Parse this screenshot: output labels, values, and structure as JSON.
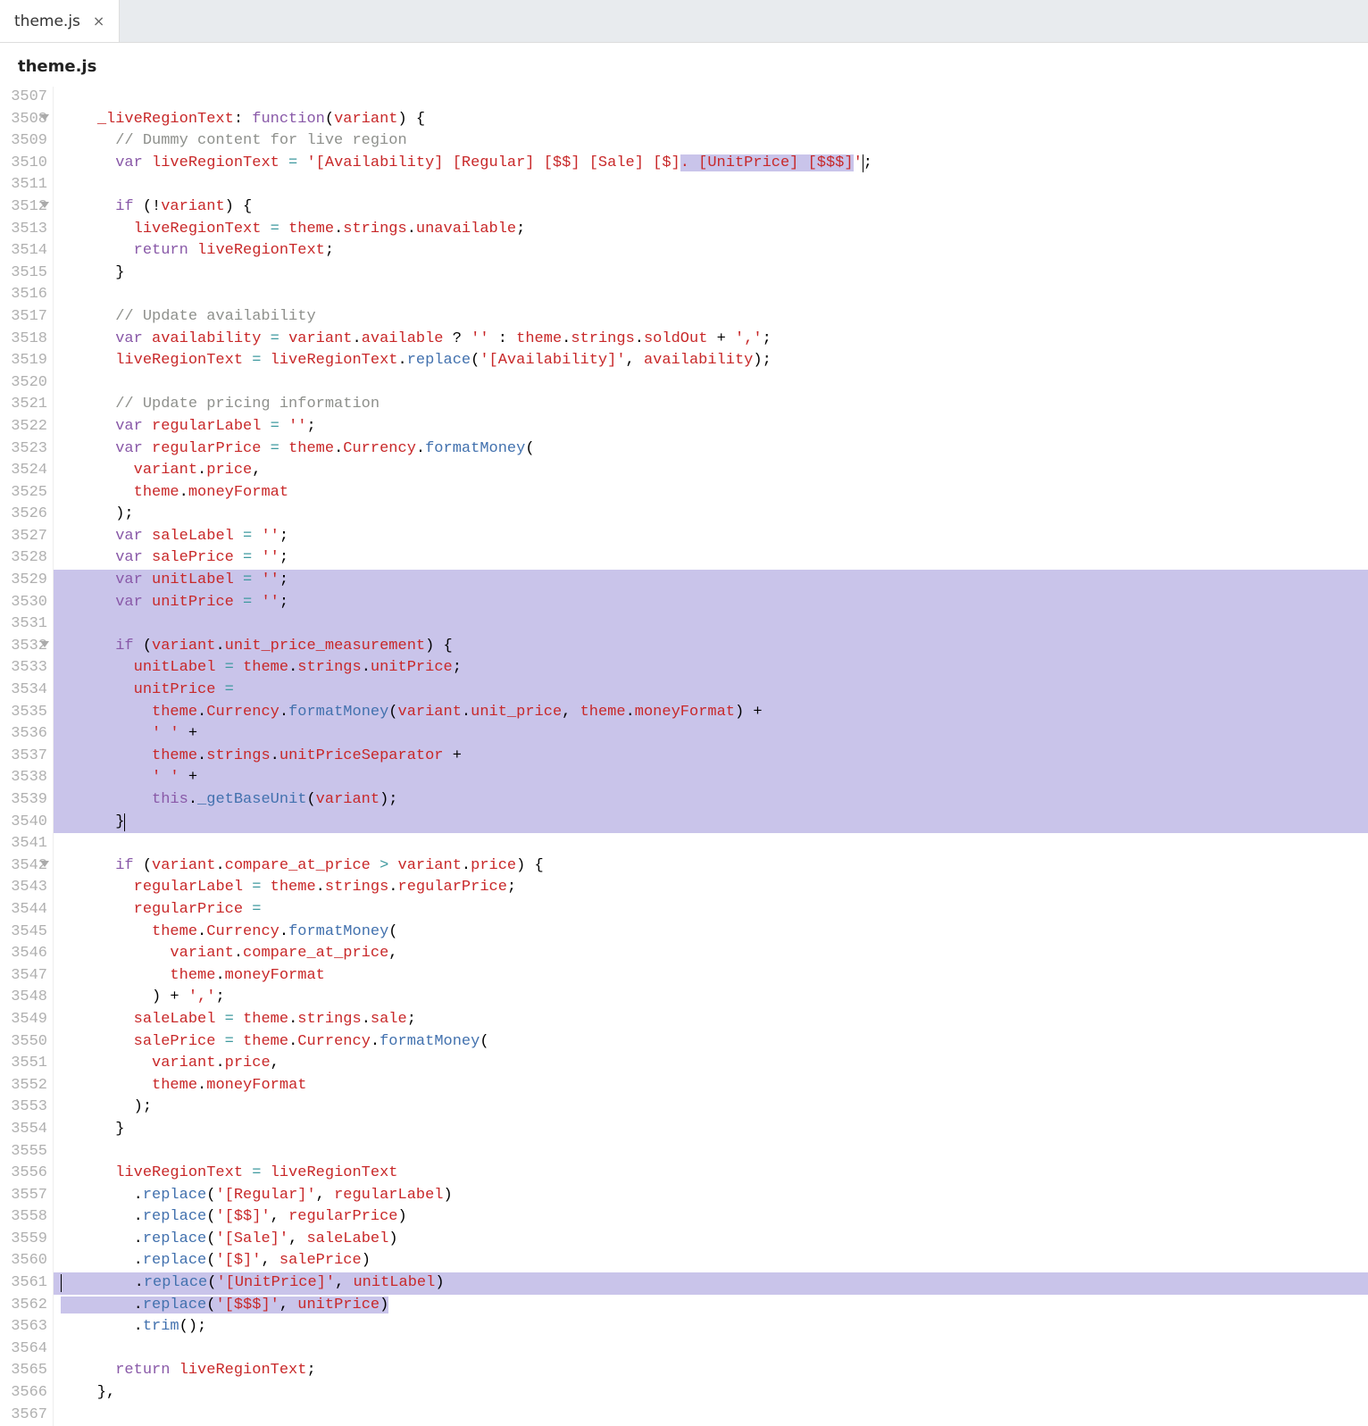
{
  "tab": {
    "label": "theme.js",
    "closeIcon": "×"
  },
  "breadcrumb": "theme.js",
  "lineNumbers": [
    "3507",
    "3508",
    "3509",
    "3510",
    "3511",
    "3512",
    "3513",
    "3514",
    "3515",
    "3516",
    "3517",
    "3518",
    "3519",
    "3520",
    "3521",
    "3522",
    "3523",
    "3524",
    "3525",
    "3526",
    "3527",
    "3528",
    "3529",
    "3530",
    "3531",
    "3532",
    "3533",
    "3534",
    "3535",
    "3536",
    "3537",
    "3538",
    "3539",
    "3540",
    "3541",
    "3542",
    "3543",
    "3544",
    "3545",
    "3546",
    "3547",
    "3548",
    "3549",
    "3550",
    "3551",
    "3552",
    "3553",
    "3554",
    "3555",
    "3556",
    "3557",
    "3558",
    "3559",
    "3560",
    "3561",
    "3562",
    "3563",
    "3564",
    "3565",
    "3566",
    "3567"
  ],
  "foldLines": [
    "3508",
    "3512",
    "3532",
    "3542"
  ],
  "code": {
    "l3507": "",
    "l3508": {
      "indent": "    ",
      "prop": "_liveRegionText",
      "colon": ": ",
      "fn": "function",
      "paren": "(",
      "arg": "variant",
      "rest": ") {"
    },
    "l3509": "      // Dummy content for live region",
    "l3510": {
      "pre": "      ",
      "kw": "var",
      "sp": " ",
      "name": "liveRegionText",
      "eq": " = ",
      "str_a": "'[Availability] [Regular] [$$] [Sale] [$]",
      "str_hl": ". [UnitPrice] [$$$]",
      "str_end": "'",
      "semi": ";"
    },
    "l3511": "",
    "l3512": {
      "pre": "      ",
      "kw": "if",
      "rest": " (!",
      "var": "variant",
      "end": ") {"
    },
    "l3513": {
      "pre": "        ",
      "a": "liveRegionText",
      "b": " = ",
      "c": "theme",
      "d": ".",
      "e": "strings",
      "f": ".",
      "g": "unavailable",
      "h": ";"
    },
    "l3514": {
      "pre": "        ",
      "kw": "return",
      "sp": " ",
      "v": "liveRegionText",
      "semi": ";"
    },
    "l3515": "      }",
    "l3516": "",
    "l3517": "      // Update availability",
    "l3518": {
      "pre": "      ",
      "kw": "var",
      "name": " availability",
      "eq": " = ",
      "a": "variant",
      "b": ".",
      "c": "available",
      "q": " ? ",
      "s1": "''",
      "col": " : ",
      "d": "theme",
      "e": ".",
      "f": "strings",
      "g": ".",
      "h": "soldOut",
      "plus": " + ",
      "s2": "','",
      "semi": ";"
    },
    "l3519": {
      "pre": "      ",
      "a": "liveRegionText",
      "eq": " = ",
      "b": "liveRegionText",
      "c": ".",
      "d": "replace",
      "paren": "(",
      "s": "'[Availability]'",
      "com": ", ",
      "e": "availability",
      "end": ");"
    },
    "l3520": "",
    "l3521": "      // Update pricing information",
    "l3522": {
      "pre": "      ",
      "kw": "var",
      "name": " regularLabel",
      "eq": " = ",
      "s": "''",
      "semi": ";"
    },
    "l3523": {
      "pre": "      ",
      "kw": "var",
      "name": " regularPrice",
      "eq": " = ",
      "a": "theme",
      "b": ".",
      "c": "Currency",
      "d": ".",
      "e": "formatMoney",
      "paren": "("
    },
    "l3524": {
      "pre": "        ",
      "a": "variant",
      "b": ".",
      "c": "price",
      "com": ","
    },
    "l3525": {
      "pre": "        ",
      "a": "theme",
      "b": ".",
      "c": "moneyFormat"
    },
    "l3526": "      );",
    "l3527": {
      "pre": "      ",
      "kw": "var",
      "name": " saleLabel",
      "eq": " = ",
      "s": "''",
      "semi": ";"
    },
    "l3528": {
      "pre": "      ",
      "kw": "var",
      "name": " salePrice",
      "eq": " = ",
      "s": "''",
      "semi": ";"
    },
    "l3529": {
      "pre": "      ",
      "kw": "var",
      "name": " unitLabel",
      "eq": " = ",
      "s": "''",
      "semi": ";"
    },
    "l3530": {
      "pre": "      ",
      "kw": "var",
      "name": " unitPrice",
      "eq": " = ",
      "s": "''",
      "semi": ";"
    },
    "l3531": "",
    "l3532": {
      "pre": "      ",
      "kw": "if",
      "paren": " (",
      "a": "variant",
      "b": ".",
      "c": "unit_price_measurement",
      "end": ") {"
    },
    "l3533": {
      "pre": "        ",
      "a": "unitLabel",
      "eq": " = ",
      "b": "theme",
      "c": ".",
      "d": "strings",
      "e": ".",
      "f": "unitPrice",
      "g": ";"
    },
    "l3534": {
      "pre": "        ",
      "a": "unitPrice",
      "eq": " ="
    },
    "l3535": {
      "pre": "          ",
      "a": "theme",
      "b": ".",
      "c": "Currency",
      "d": ".",
      "e": "formatMoney",
      "paren": "(",
      "f": "variant",
      "g": ".",
      "h": "unit_price",
      "com": ", ",
      "i": "theme",
      "j": ".",
      "k": "moneyFormat",
      "end": ") +"
    },
    "l3536": {
      "pre": "          ",
      "s": "' '",
      "plus": " +"
    },
    "l3537": {
      "pre": "          ",
      "a": "theme",
      "b": ".",
      "c": "strings",
      "d": ".",
      "e": "unitPriceSeparator",
      "plus": " +"
    },
    "l3538": {
      "pre": "          ",
      "s": "' '",
      "plus": " +"
    },
    "l3539": {
      "pre": "          ",
      "th": "this",
      "b": ".",
      "c": "_getBaseUnit",
      "paren": "(",
      "d": "variant",
      "end": ");"
    },
    "l3540": "      }",
    "l3541": "",
    "l3542": {
      "pre": "      ",
      "kw": "if",
      "paren": " (",
      "a": "variant",
      "b": ".",
      "c": "compare_at_price",
      "op": " > ",
      "d": "variant",
      "e": ".",
      "f": "price",
      "end": ") {"
    },
    "l3543": {
      "pre": "        ",
      "a": "regularLabel",
      "eq": " = ",
      "b": "theme",
      "c": ".",
      "d": "strings",
      "e": ".",
      "f": "regularPrice",
      "g": ";"
    },
    "l3544": {
      "pre": "        ",
      "a": "regularPrice",
      "eq": " ="
    },
    "l3545": {
      "pre": "          ",
      "a": "theme",
      "b": ".",
      "c": "Currency",
      "d": ".",
      "e": "formatMoney",
      "paren": "("
    },
    "l3546": {
      "pre": "            ",
      "a": "variant",
      "b": ".",
      "c": "compare_at_price",
      "com": ","
    },
    "l3547": {
      "pre": "            ",
      "a": "theme",
      "b": ".",
      "c": "moneyFormat"
    },
    "l3548": {
      "pre": "          ) + ",
      "s": "','",
      "semi": ";"
    },
    "l3549": {
      "pre": "        ",
      "a": "saleLabel",
      "eq": " = ",
      "b": "theme",
      "c": ".",
      "d": "strings",
      "e": ".",
      "f": "sale",
      "g": ";"
    },
    "l3550": {
      "pre": "        ",
      "a": "salePrice",
      "eq": " = ",
      "b": "theme",
      "c": ".",
      "d": "Currency",
      "e": ".",
      "f": "formatMoney",
      "paren": "("
    },
    "l3551": {
      "pre": "          ",
      "a": "variant",
      "b": ".",
      "c": "price",
      "com": ","
    },
    "l3552": {
      "pre": "          ",
      "a": "theme",
      "b": ".",
      "c": "moneyFormat"
    },
    "l3553": "        );",
    "l3554": "      }",
    "l3555": "",
    "l3556": {
      "pre": "      ",
      "a": "liveRegionText",
      "eq": " = ",
      "b": "liveRegionText"
    },
    "l3557": {
      "pre": "        .",
      "a": "replace",
      "paren": "(",
      "s": "'[Regular]'",
      "com": ", ",
      "b": "regularLabel",
      "end": ")"
    },
    "l3558": {
      "pre": "        .",
      "a": "replace",
      "paren": "(",
      "s": "'[$$]'",
      "com": ", ",
      "b": "regularPrice",
      "end": ")"
    },
    "l3559": {
      "pre": "        .",
      "a": "replace",
      "paren": "(",
      "s": "'[Sale]'",
      "com": ", ",
      "b": "saleLabel",
      "end": ")"
    },
    "l3560": {
      "pre": "        .",
      "a": "replace",
      "paren": "(",
      "s": "'[$]'",
      "com": ", ",
      "b": "salePrice",
      "end": ")"
    },
    "l3561": {
      "pre": "        .",
      "a": "replace",
      "paren": "(",
      "s": "'[UnitPrice]'",
      "com": ", ",
      "b": "unitLabel",
      "end": ")"
    },
    "l3562": {
      "pre": "        .",
      "a": "replace",
      "paren": "(",
      "s": "'[$$$]'",
      "com": ", ",
      "b": "unitPrice",
      "end": ")"
    },
    "l3563": {
      "pre": "        .",
      "a": "trim",
      "end": "();"
    },
    "l3564": "",
    "l3565": {
      "pre": "      ",
      "kw": "return",
      "sp": " ",
      "v": "liveRegionText",
      "semi": ";"
    },
    "l3566": "    },",
    "l3567": ""
  }
}
